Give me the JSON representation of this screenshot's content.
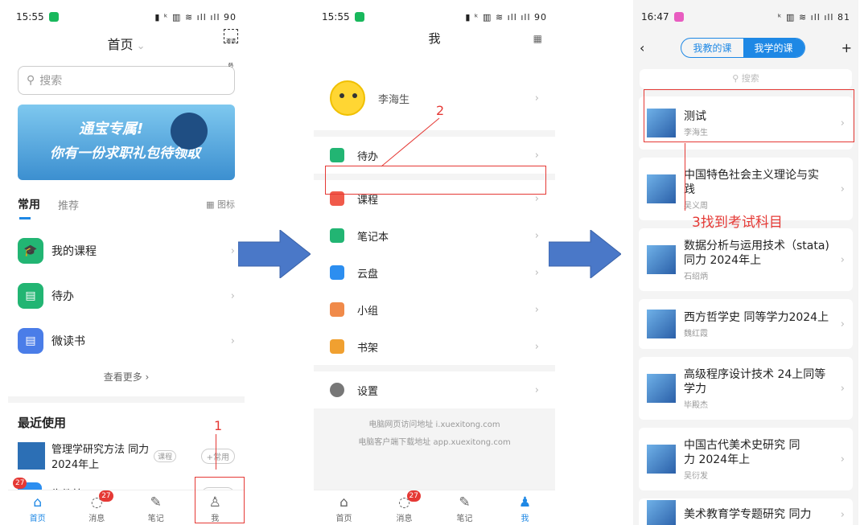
{
  "p1": {
    "status_time": "15:55",
    "status_right": "▮ ᵏ ▥ ≋ ıll ıll 90",
    "title": "首页",
    "invite": "邀请码",
    "search_placeholder": "搜索",
    "banner_line1": "通宝专属!",
    "banner_line2": "你有一份求职礼包待领取",
    "tab_common": "常用",
    "tab_recommend": "推荐",
    "tab_icon": "▦ 图标",
    "apps": [
      {
        "label": "我的课程",
        "color": "#22b573",
        "glyph": "🎓"
      },
      {
        "label": "待办",
        "color": "#22b573",
        "glyph": "▤"
      },
      {
        "label": "微读书",
        "color": "#4a7de8",
        "glyph": "▤"
      }
    ],
    "more": "查看更多 ›",
    "recent_title": "最近使用",
    "recent_course": "管理学研究方法 同力",
    "recent_course2": "2024年上",
    "recent_tag": "课程",
    "add_common": "+常用",
    "mail_label": "收件箱",
    "mail_badge": "27",
    "nav": [
      {
        "label": "首页",
        "glyph": "⌂"
      },
      {
        "label": "消息",
        "glyph": "◌",
        "badge": "27"
      },
      {
        "label": "笔记",
        "glyph": "✎"
      },
      {
        "label": "我",
        "glyph": "♙"
      }
    ],
    "annot": "1"
  },
  "p2": {
    "status_time": "15:55",
    "status_right": "▮ ᵏ ▥ ≋ ıll ıll 90",
    "title": "我",
    "username": "李海生",
    "todo": "待办",
    "menu": [
      {
        "label": "课程",
        "color": "#f05a4a"
      },
      {
        "label": "笔记本",
        "color": "#22b573"
      },
      {
        "label": "云盘",
        "color": "#2c8ef0"
      },
      {
        "label": "小组",
        "color": "#f08a4a"
      },
      {
        "label": "书架",
        "color": "#f0a030"
      }
    ],
    "settings": "设置",
    "foot1": "电脑网页访问地址 i.xuexitong.com",
    "foot2": "电脑客户端下载地址 app.xuexitong.com",
    "nav": [
      {
        "label": "首页",
        "glyph": "⌂"
      },
      {
        "label": "消息",
        "glyph": "◌",
        "badge": "27"
      },
      {
        "label": "笔记",
        "glyph": "✎"
      },
      {
        "label": "我",
        "glyph": "♟"
      }
    ],
    "annot": "2"
  },
  "p3": {
    "status_time": "16:47",
    "status_right": "ᵏ ▥ ≋ ıll ıll 81",
    "seg_teach": "我教的课",
    "seg_learn": "我学的课",
    "search_placeholder": "搜索",
    "courses": [
      {
        "line1": "测试",
        "line2": "",
        "author": "李海生"
      },
      {
        "line1": "中国特色社会主义理论与实",
        "line2": "践",
        "author": "吴义周"
      },
      {
        "line1": "数据分析与运用技术（stata)",
        "line2": "同力 2024年上",
        "author": "石绍炳"
      },
      {
        "line1": "西方哲学史 同等学力2024上",
        "line2": "",
        "author": "魏红霞"
      },
      {
        "line1": "高级程序设计技术 24上同等",
        "line2": "学力",
        "author": "毕殿杰"
      },
      {
        "line1": "中国古代美术史研究 同",
        "line2": "力 2024年上",
        "author": "吴衍发"
      },
      {
        "line1": "美术教育学专题研究 同力",
        "line2": "",
        "author": ""
      }
    ],
    "annot": "3找到考试科目"
  }
}
